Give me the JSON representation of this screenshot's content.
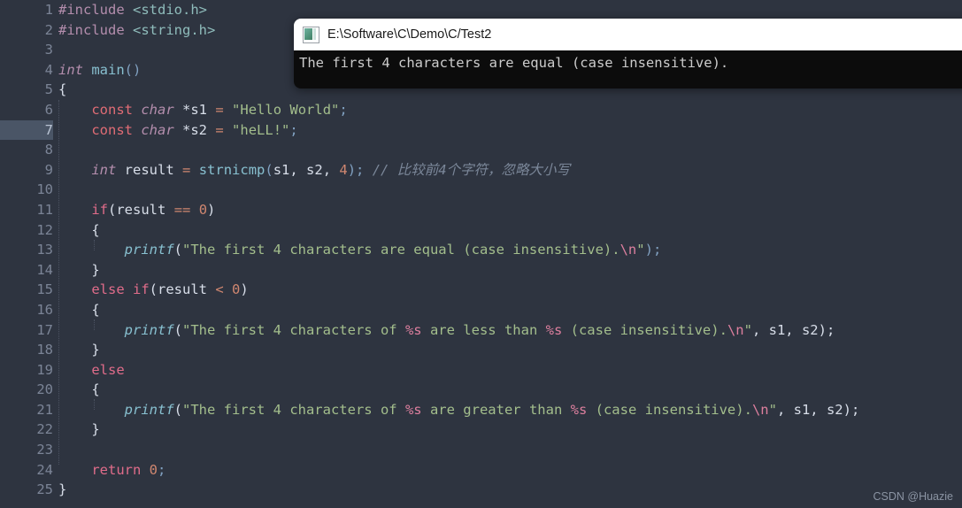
{
  "editor": {
    "background_color": "#2e3440",
    "gutter_text_color": "#7b8496",
    "active_line_number": "7",
    "active_line_bg": "#4a5566",
    "lines": [
      {
        "num": "1",
        "active": false
      },
      {
        "num": "2",
        "active": false
      },
      {
        "num": "3",
        "active": false
      },
      {
        "num": "4",
        "active": false
      },
      {
        "num": "5",
        "active": false
      },
      {
        "num": "6",
        "active": false
      },
      {
        "num": "7",
        "active": true
      },
      {
        "num": "8",
        "active": false
      },
      {
        "num": "9",
        "active": false
      },
      {
        "num": "10",
        "active": false
      },
      {
        "num": "11",
        "active": false
      },
      {
        "num": "12",
        "active": false
      },
      {
        "num": "13",
        "active": false
      },
      {
        "num": "14",
        "active": false
      },
      {
        "num": "15",
        "active": false
      },
      {
        "num": "16",
        "active": false
      },
      {
        "num": "17",
        "active": false
      },
      {
        "num": "18",
        "active": false
      },
      {
        "num": "19",
        "active": false
      },
      {
        "num": "20",
        "active": false
      },
      {
        "num": "21",
        "active": false
      },
      {
        "num": "22",
        "active": false
      },
      {
        "num": "23",
        "active": false
      },
      {
        "num": "24",
        "active": false
      },
      {
        "num": "25",
        "active": false
      }
    ],
    "code": {
      "l1_include": "#include",
      "l1_header": "<stdio.h>",
      "l2_include": "#include",
      "l2_header": "<string.h>",
      "l4_type": "int",
      "l4_name": "main",
      "l4_parens": "()",
      "l5_brace": "{",
      "l6_const": "const",
      "l6_type": "char",
      "l6_star_name": "*s1",
      "l6_eq": "=",
      "l6_str": "\"Hello World\"",
      "l6_semi": ";",
      "l7_const": "const",
      "l7_type": "char",
      "l7_star_name": "*s2",
      "l7_eq": "=",
      "l7_str": "\"heLL!\"",
      "l7_semi": ";",
      "l9_type": "int",
      "l9_var": "result",
      "l9_eq": "=",
      "l9_call": "strnicmp",
      "l9_args_open": "(",
      "l9_args": "s1, s2, ",
      "l9_num": "4",
      "l9_args_close": ");",
      "l9_comment": "// 比较前4个字符，忽略大小写",
      "l11_kw": "if",
      "l11_open": "(",
      "l11_var": "result",
      "l11_op": "==",
      "l11_num": "0",
      "l11_close": ")",
      "l12_brace": "{",
      "l13_fn": "printf",
      "l13_open": "(",
      "l13_str": "\"The first 4 characters are equal (case insensitive).",
      "l13_esc": "\\n",
      "l13_strend": "\"",
      "l13_close": ");",
      "l14_brace": "}",
      "l15_else": "else",
      "l15_if": "if",
      "l15_open": "(",
      "l15_var": "result",
      "l15_op": "<",
      "l15_num": "0",
      "l15_close": ")",
      "l16_brace": "{",
      "l17_fn": "printf",
      "l17_open": "(",
      "l17_str1": "\"The first 4 characters of ",
      "l17_pct1": "%s",
      "l17_str2": " are less than ",
      "l17_pct2": "%s",
      "l17_str3": " (case insensitive).",
      "l17_esc": "\\n",
      "l17_strend": "\"",
      "l17_args": ", s1, s2);",
      "l18_brace": "}",
      "l19_else": "else",
      "l20_brace": "{",
      "l21_fn": "printf",
      "l21_open": "(",
      "l21_str1": "\"The first 4 characters of ",
      "l21_pct1": "%s",
      "l21_str2": " are greater than ",
      "l21_pct2": "%s",
      "l21_str3": " (case insensitive).",
      "l21_esc": "\\n",
      "l21_strend": "\"",
      "l21_args": ", s1, s2);",
      "l22_brace": "}",
      "l24_return": "return",
      "l24_num": "0",
      "l24_semi": ";",
      "l25_brace": "}"
    }
  },
  "console_window": {
    "icon": "console-app-icon",
    "title": "E:\\Software\\C\\Demo\\C/Test2",
    "output_line": "The first 4 characters are equal (case insensitive).",
    "titlebar_color": "#ffffff",
    "body_color": "#0c0c0c",
    "output_text_color": "#cccccc"
  },
  "watermark": {
    "text": "CSDN @Huazie"
  }
}
